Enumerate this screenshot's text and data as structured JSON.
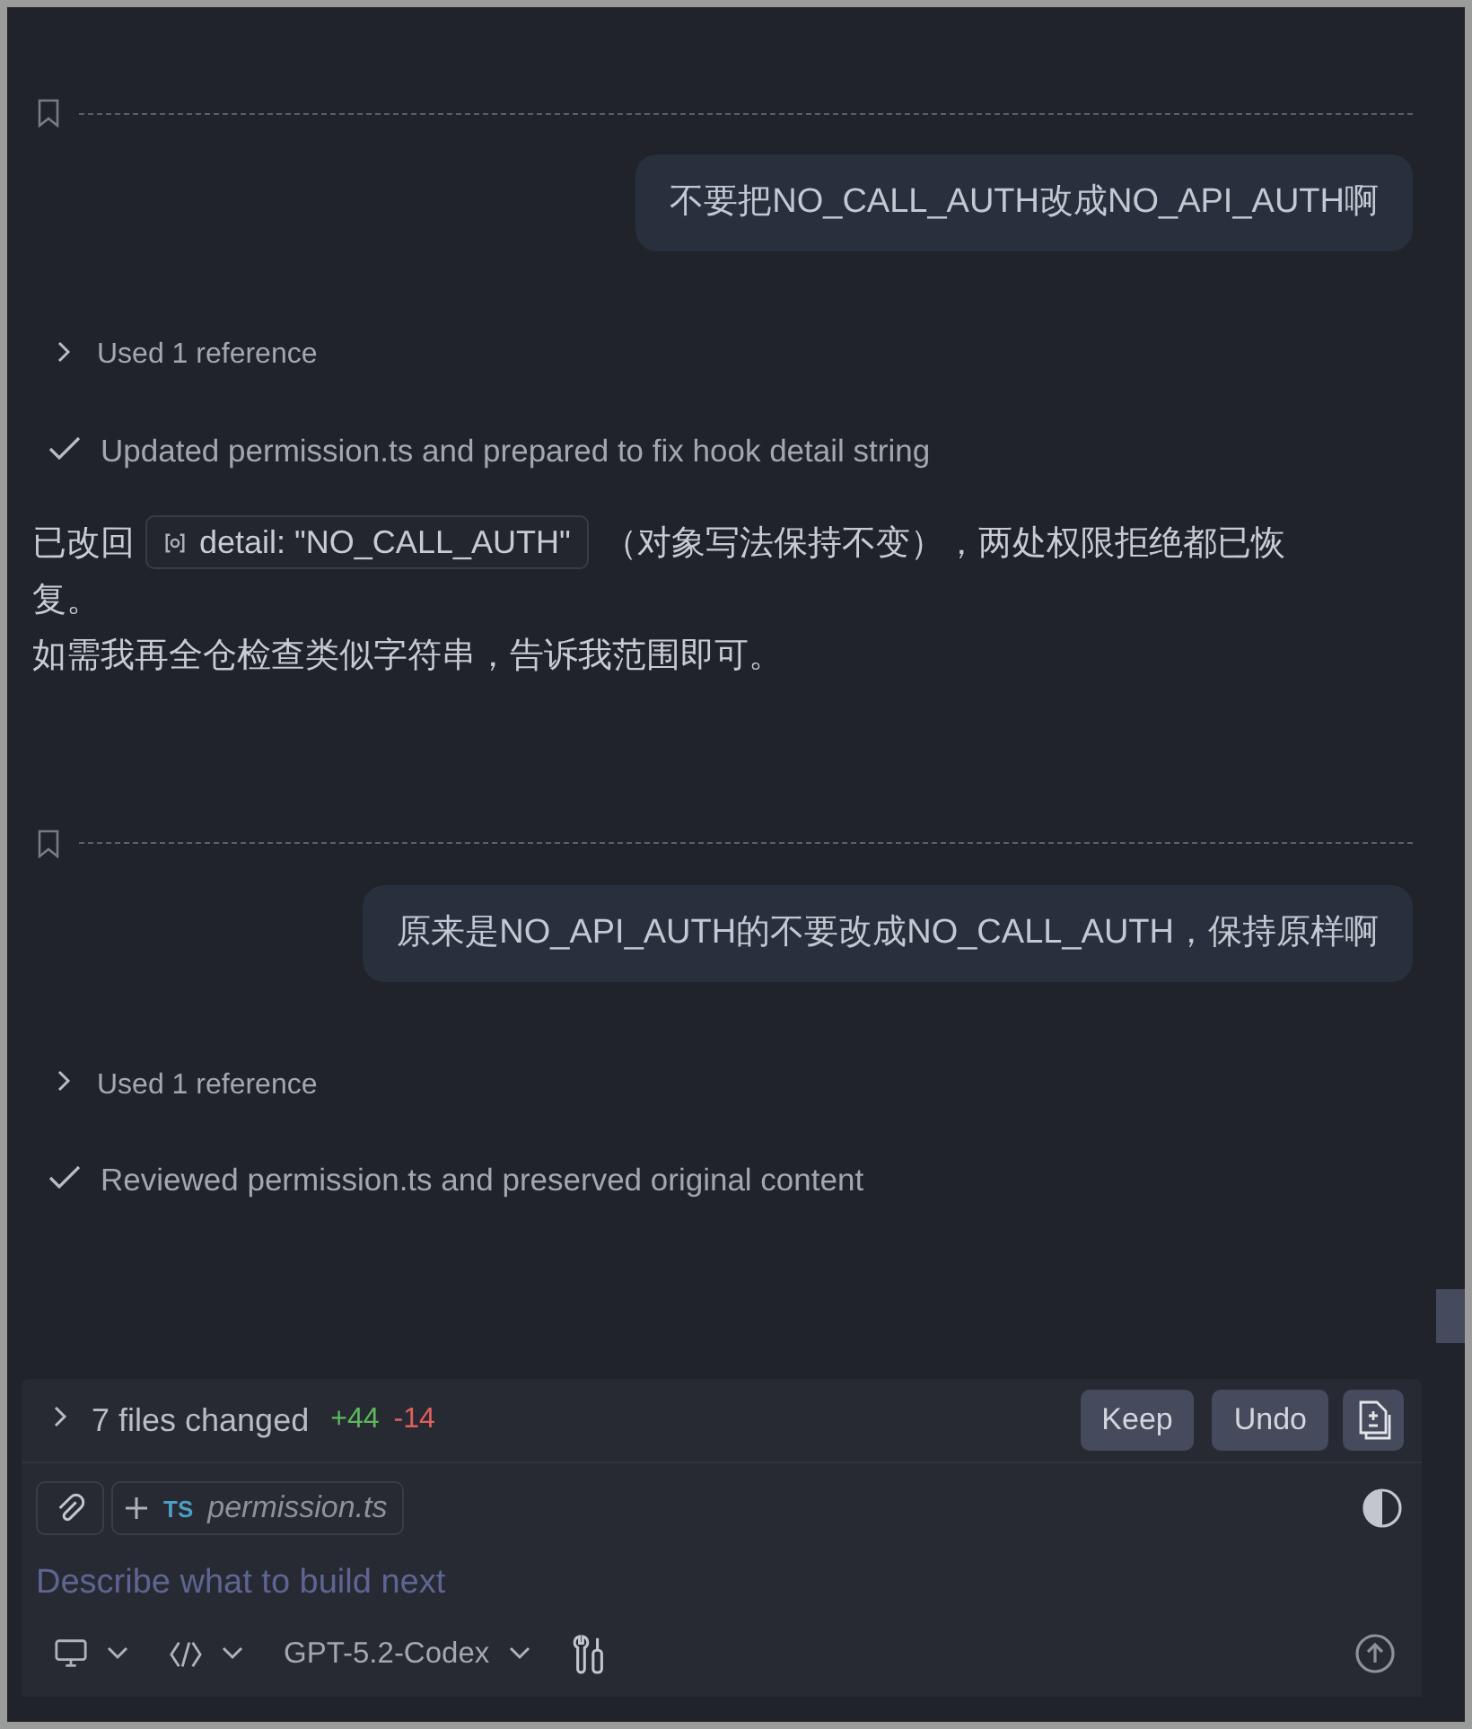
{
  "turns": [
    {
      "user_message": "不要把NO_CALL_AUTH改成NO_API_AUTH啊",
      "reference": {
        "label": "Used 1 reference",
        "expanded": false
      },
      "step": {
        "label": "Updated permission.ts and prepared to fix hook detail string",
        "done": true
      },
      "reply": [
        {
          "parts": [
            {
              "kind": "text",
              "text": "已改回"
            },
            {
              "kind": "code",
              "text": "detail: \"NO_CALL_AUTH\""
            },
            {
              "kind": "text",
              "text": "（对象写法保持不变），两处权限拒绝都已恢复。"
            }
          ]
        },
        {
          "parts": [
            {
              "kind": "text",
              "text": "如需我再全仓检查类似字符串，告诉我范围即可。"
            }
          ]
        }
      ]
    },
    {
      "user_message": "原来是NO_API_AUTH的不要改成NO_CALL_AUTH，保持原样啊",
      "reference": {
        "label": "Used 1 reference",
        "expanded": false
      },
      "step": {
        "label": "Reviewed permission.ts and preserved original content",
        "done": true
      }
    }
  ],
  "changes": {
    "label": "7 files changed",
    "added": "+44",
    "removed": "-14",
    "expanded": false,
    "buttons": [
      "Keep",
      "Undo"
    ]
  },
  "context": {
    "file_type": "TS",
    "file_name": "permission.ts"
  },
  "input": {
    "placeholder": "Describe what to build next"
  },
  "toolbar": {
    "model": "GPT-5.2-Codex"
  }
}
